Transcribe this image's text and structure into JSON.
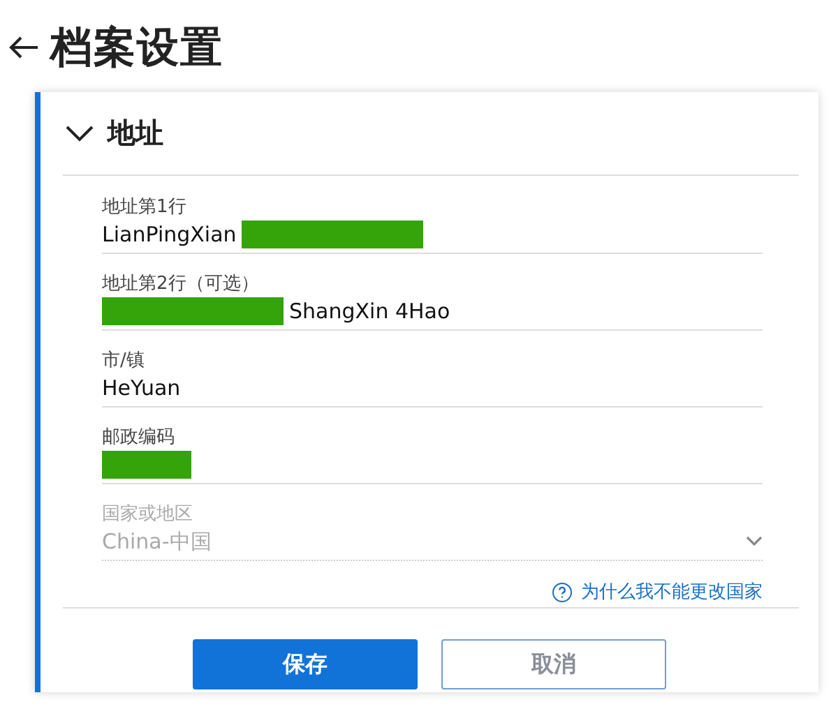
{
  "page": {
    "title": "档案设置"
  },
  "section": {
    "title": "地址",
    "expanded": true,
    "fields": [
      {
        "label": "地址第1行",
        "kind": "text",
        "disabled": false,
        "parts": [
          {
            "kind": "text",
            "text": "LianPingXian"
          },
          {
            "kind": "redacted"
          }
        ]
      },
      {
        "label": "地址第2行（可选）",
        "kind": "text",
        "disabled": false,
        "parts": [
          {
            "kind": "redacted"
          },
          {
            "kind": "text",
            "text": "ShangXin 4Hao"
          }
        ]
      },
      {
        "label": "市/镇",
        "kind": "text",
        "disabled": false,
        "parts": [
          {
            "kind": "text",
            "text": "HeYuan"
          }
        ]
      },
      {
        "label": "邮政编码",
        "kind": "text",
        "disabled": false,
        "parts": [
          {
            "kind": "redacted_short"
          }
        ]
      },
      {
        "label": "国家或地区",
        "kind": "select",
        "disabled": true,
        "parts": [
          {
            "kind": "text",
            "text": "China-中国"
          }
        ]
      }
    ],
    "help_link": "为什么我不能更改国家"
  },
  "buttons": [
    {
      "label": "保存",
      "kind": "primary",
      "disabled": false
    },
    {
      "label": "取消",
      "kind": "secondary",
      "disabled": true
    }
  ]
}
